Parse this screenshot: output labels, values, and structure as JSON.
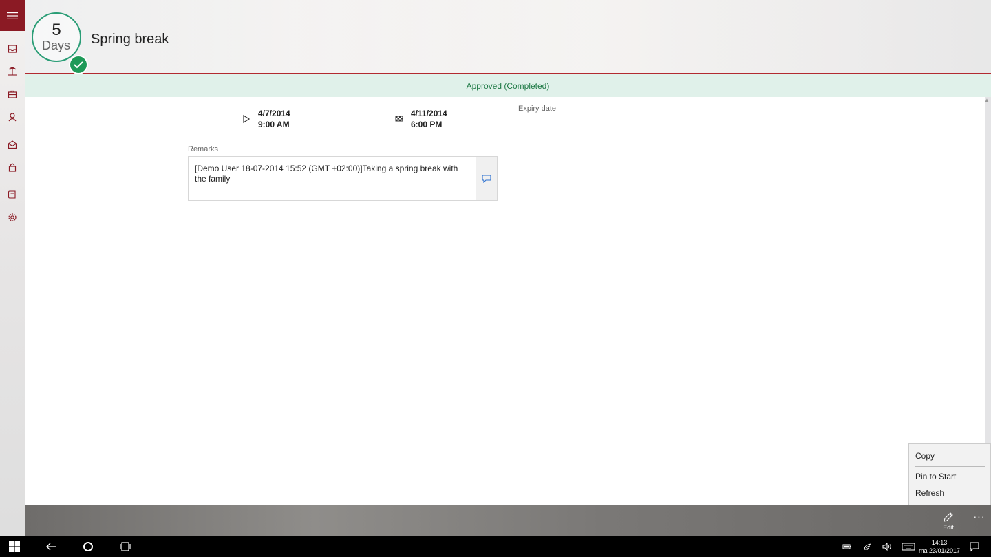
{
  "header": {
    "days_number": "5",
    "days_unit": "Days",
    "title": "Spring break"
  },
  "status": {
    "text": "Approved (Completed)"
  },
  "dates": {
    "start_date": "4/7/2014",
    "start_time": "9:00 AM",
    "end_date": "4/11/2014",
    "end_time": "6:00 PM",
    "expiry_label": "Expiry date"
  },
  "remarks": {
    "label": "Remarks",
    "text": "[Demo User 18-07-2014 15:52 (GMT +02:00)]Taking a spring break with the family"
  },
  "context_menu": {
    "copy": "Copy",
    "pin": "Pin to Start",
    "refresh": "Refresh"
  },
  "appbar": {
    "edit_label": "Edit",
    "more_label": "···"
  },
  "taskbar": {
    "time": "14:13",
    "date": "ma 23/01/2017"
  },
  "sidebar": {
    "icons": [
      "inbox-icon",
      "beach-icon",
      "briefcase-icon",
      "person-icon",
      "mail-open-icon",
      "lock-icon",
      "book-icon",
      "gear-icon"
    ]
  },
  "colors": {
    "accent": "#8b1a24",
    "approved_green": "#1e9a58",
    "status_bg": "#e0f1ea"
  }
}
